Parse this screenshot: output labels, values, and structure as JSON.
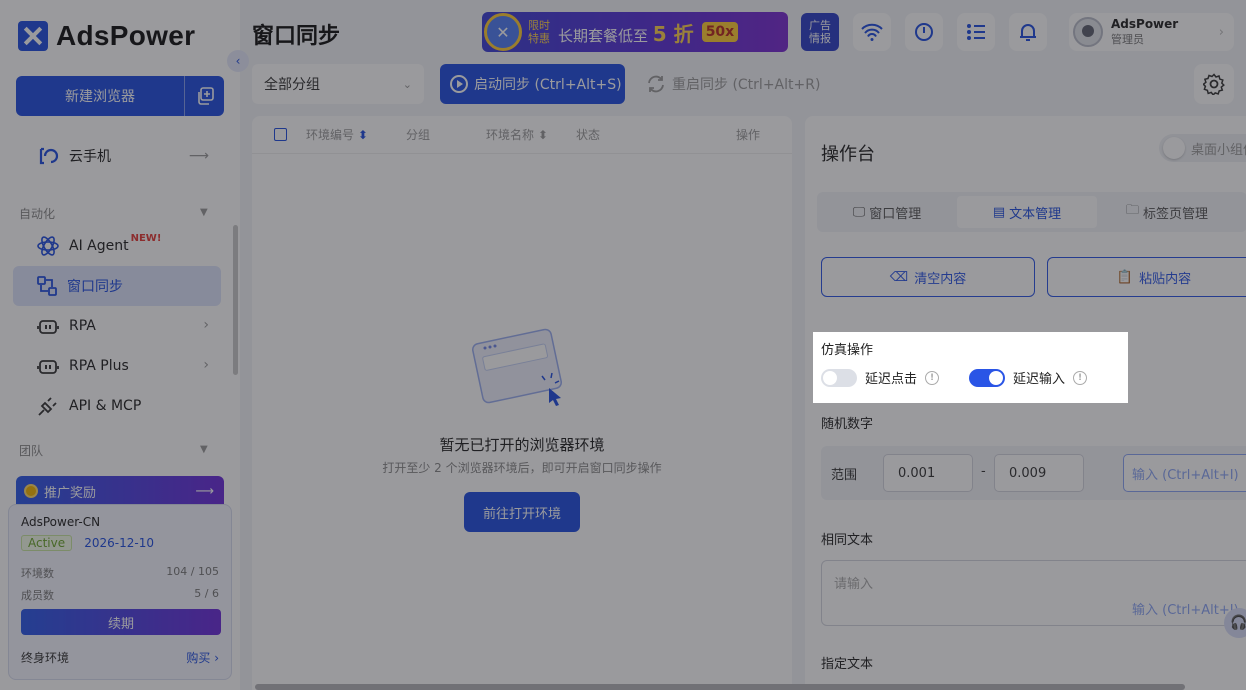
{
  "app": {
    "logo_text": "AdsPower",
    "page_title": "窗口同步"
  },
  "sidebar": {
    "new_browser_label": "新建浏览器",
    "cloud_phone_label": "云手机",
    "section_automation": "自动化",
    "section_team": "团队",
    "items": [
      {
        "label": "AI Agent",
        "badge": "NEW!"
      },
      {
        "label": "窗口同步",
        "active": true
      },
      {
        "label": "RPA"
      },
      {
        "label": "RPA Plus"
      },
      {
        "label": "API & MCP"
      }
    ],
    "promo_label": "推广奖励",
    "account": {
      "name": "AdsPower-CN",
      "status": "Active",
      "expiry": "2026-12-10",
      "env_label": "环境数",
      "env_value": "104 / 105",
      "member_label": "成员数",
      "member_value": "5 / 6",
      "renew_label": "续期",
      "lifetime_label": "终身环境",
      "buy_label": "购买"
    }
  },
  "header": {
    "ad_banner": {
      "limited_line1": "限时",
      "limited_line2": "特惠",
      "main_text": "长期套餐低至",
      "discount": "5 折",
      "x50": "50x"
    },
    "ad_tag_line1": "广告",
    "ad_tag_line2": "情报",
    "user": {
      "name": "AdsPower",
      "role": "管理员"
    }
  },
  "toolbar": {
    "group_select_value": "全部分组",
    "start_sync_label": "启动同步 (Ctrl+Alt+S)",
    "restart_sync_label": "重启同步 (Ctrl+Alt+R)"
  },
  "table": {
    "columns": [
      "环境编号",
      "分组",
      "环境名称",
      "状态",
      "操作"
    ],
    "empty_title": "暂无已打开的浏览器环境",
    "empty_subtitle": "打开至少 2 个浏览器环境后，即可开启窗口同步操作",
    "goto_button": "前往打开环境"
  },
  "console": {
    "title": "操作台",
    "desktop_toggle_label": "桌面小组件",
    "tabs": [
      {
        "label": "窗口管理"
      },
      {
        "label": "文本管理",
        "active": true
      },
      {
        "label": "标签页管理"
      }
    ],
    "clear_button": "清空内容",
    "paste_button": "粘贴内容",
    "sim_title": "仿真操作",
    "delay_click_label": "延迟点击",
    "delay_click_on": false,
    "delay_input_label": "延迟输入",
    "delay_input_on": true,
    "random_number_title": "随机数字",
    "range_label": "范围",
    "range_min": "0.001",
    "range_sep": "-",
    "range_max": "0.009",
    "range_input_hint": "输入 (Ctrl+Alt+I)",
    "same_text_title": "相同文本",
    "same_text_placeholder": "请输入",
    "same_text_hint": "输入 (Ctrl+Alt+I)",
    "specified_text_title": "指定文本"
  }
}
